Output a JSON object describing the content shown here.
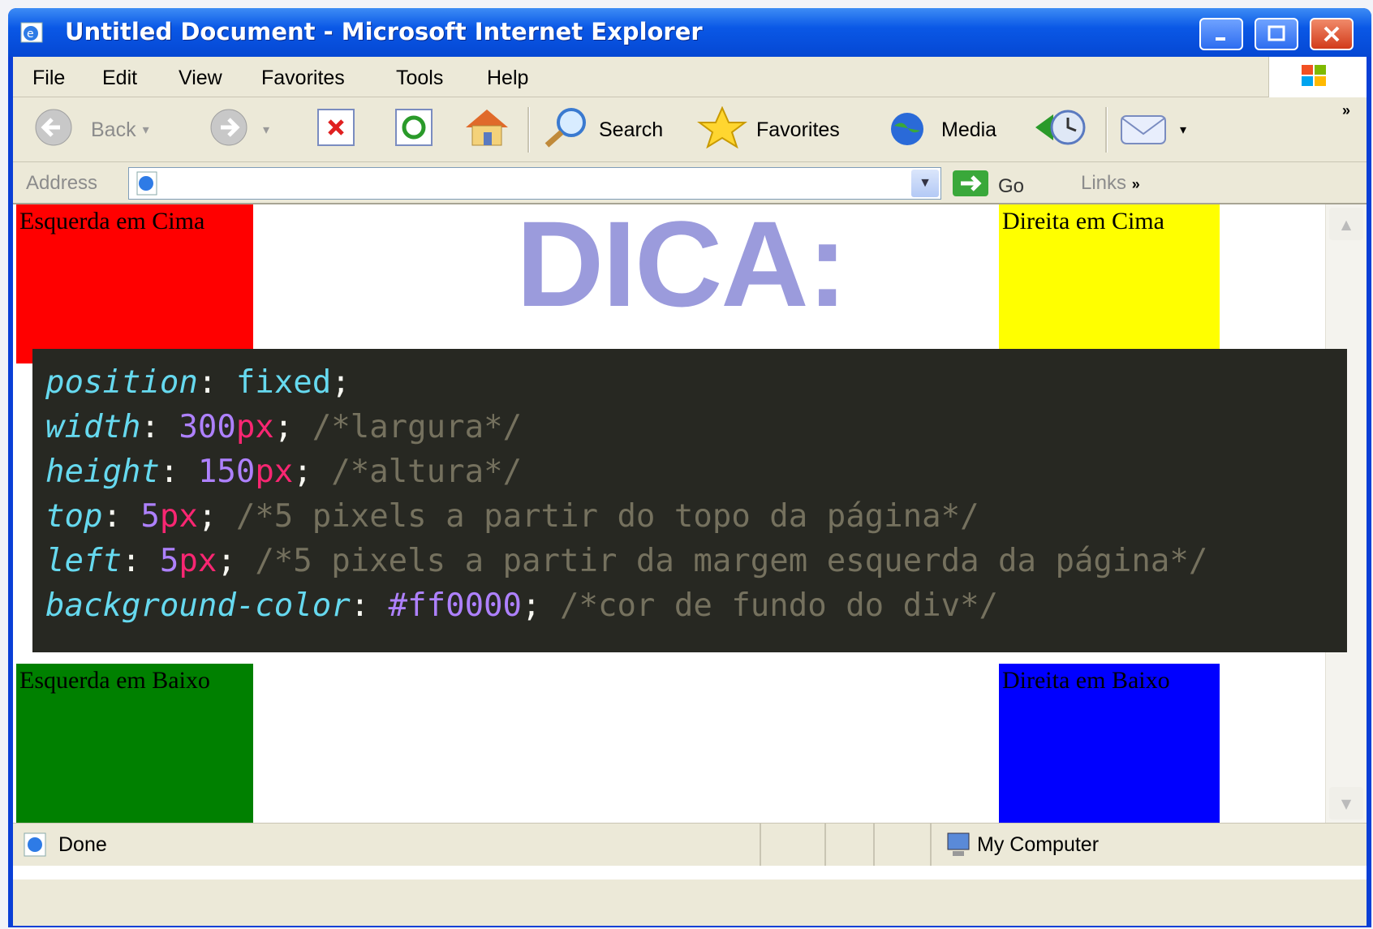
{
  "window": {
    "title": "Untitled Document - Microsoft Internet Explorer"
  },
  "menu": [
    "File",
    "Edit",
    "View",
    "Favorites",
    "Tools",
    "Help"
  ],
  "toolbar": {
    "back": "Back",
    "search": "Search",
    "favorites": "Favorites",
    "media": "Media"
  },
  "address": {
    "label": "Address",
    "value": "",
    "go": "Go",
    "links": "Links"
  },
  "page": {
    "top_left": "Esquerda em Cima",
    "top_right": "Direita em Cima",
    "bottom_left": "Esquerda em Baixo",
    "bottom_right": "Direita em Baixo",
    "colors": {
      "top_left": "#ff0000",
      "top_right": "#ffff00",
      "bottom_left": "#008000",
      "bottom_right": "#0000ff"
    }
  },
  "status": {
    "text": "Done",
    "zone": "My Computer"
  },
  "slide": {
    "heading": "DICA:",
    "code": [
      {
        "prop": "position",
        "value": "fixed",
        "num": "",
        "unit": "",
        "comment": ""
      },
      {
        "prop": "width",
        "value": "",
        "num": "300",
        "unit": "px",
        "comment": "/*largura*/"
      },
      {
        "prop": "height",
        "value": "",
        "num": "150",
        "unit": "px",
        "comment": "/*altura*/"
      },
      {
        "prop": "top",
        "value": "",
        "num": "5",
        "unit": "px",
        "comment": "/*5 pixels a partir do topo da página*/"
      },
      {
        "prop": "left",
        "value": "",
        "num": "5",
        "unit": "px",
        "comment": "/*5 pixels a partir da margem esquerda da página*/"
      },
      {
        "prop": "background-color",
        "value": "",
        "num": "#ff0000",
        "unit": "",
        "comment": "/*cor de fundo do div*/"
      }
    ]
  }
}
